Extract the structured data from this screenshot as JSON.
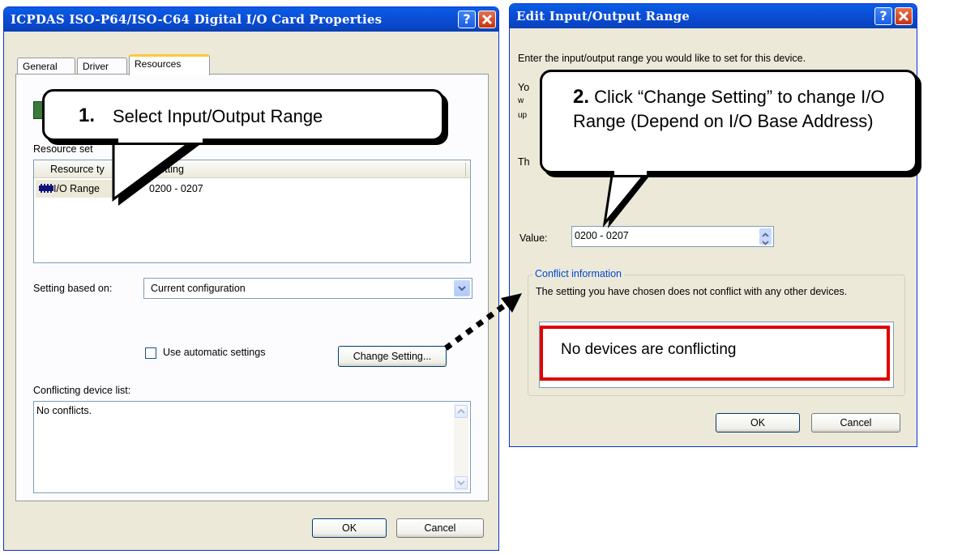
{
  "left_dialog": {
    "title": "ICPDAS ISO-P64/ISO-C64 Digital I/O Card Properties",
    "help_label": "?",
    "tabs": [
      {
        "label": "General"
      },
      {
        "label": "Driver"
      },
      {
        "label": "Resources"
      }
    ],
    "resource_settings_label": "Resource set",
    "columns": {
      "type": "Resource ty",
      "setting": "Setting"
    },
    "row": {
      "type": "I/O Range",
      "setting": "0200 - 0207"
    },
    "setting_based_label": "Setting based on:",
    "setting_based_value": "Current configuration",
    "auto_label": "Use automatic settings",
    "change_button": "Change Setting...",
    "conflict_label": "Conflicting device list:",
    "conflict_text": "No conflicts.",
    "ok": "OK",
    "cancel": "Cancel"
  },
  "right_dialog": {
    "title": "Edit Input/Output Range",
    "help_label": "?",
    "intro": "Enter the input/output range you would like to set for this device.",
    "hidden_fragments": [
      "Yo",
      "w",
      "up",
      "Th"
    ],
    "value_label": "Value:",
    "value": "0200 - 0207",
    "conflict_group": "Conflict information",
    "conflict_desc": "The setting you have chosen does not conflict with any other devices.",
    "conflict_box": "No devices are conflicting",
    "ok": "OK",
    "cancel": "Cancel"
  },
  "callouts": {
    "one_number": "1.",
    "one_text": "Select Input/Output Range",
    "two_number": "2.",
    "two_text": "Click “Change Setting” to change I/O Range (Depend on I/O Base Address)"
  },
  "colors": {
    "highlight_border": "#e00000",
    "title_blue": "#0a5ee6",
    "dialog_bg": "#ece9d8"
  }
}
